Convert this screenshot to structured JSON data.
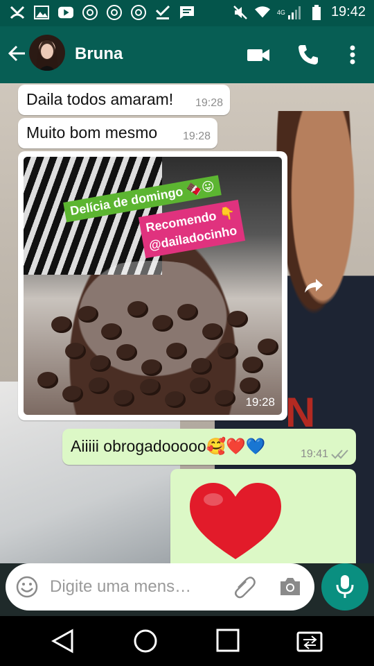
{
  "status_bar": {
    "time": "19:42",
    "network": "4G",
    "left_icons": [
      "missed-call-icon",
      "gallery-icon",
      "youtube-icon",
      "chrome-icon",
      "chrome-icon",
      "chrome-icon",
      "download-done-icon",
      "message-icon"
    ],
    "right_icons": [
      "mute-icon",
      "wifi-icon",
      "signal-icon",
      "battery-icon"
    ]
  },
  "header": {
    "contact_name": "Bruna",
    "icons": [
      "back-arrow-icon",
      "video-call-icon",
      "phone-icon",
      "more-vert-icon"
    ]
  },
  "messages": [
    {
      "type": "incoming",
      "text": "Daila todos amaram!",
      "time": "19:28"
    },
    {
      "type": "incoming",
      "text": "Muito bom mesmo",
      "time": "19:28"
    },
    {
      "type": "incoming-image",
      "sticker_1": "Delícia de domingo 🍫😛",
      "sticker_2_line1": "Recomendo 👇",
      "sticker_2_line2": "@dailadocinho",
      "time": "19:28"
    },
    {
      "type": "outgoing",
      "text": "Aiiiii obrogadooooo🥰❤️💙",
      "time": "19:41",
      "status": "read"
    },
    {
      "type": "outgoing-emoji",
      "emoji": "heart"
    }
  ],
  "input": {
    "placeholder": "Digite uma mens…"
  },
  "colors": {
    "header": "#075e54",
    "status_bar": "#04554b",
    "outgoing": "#dcf8c6",
    "incoming": "#ffffff",
    "mic": "#0a8f80"
  }
}
